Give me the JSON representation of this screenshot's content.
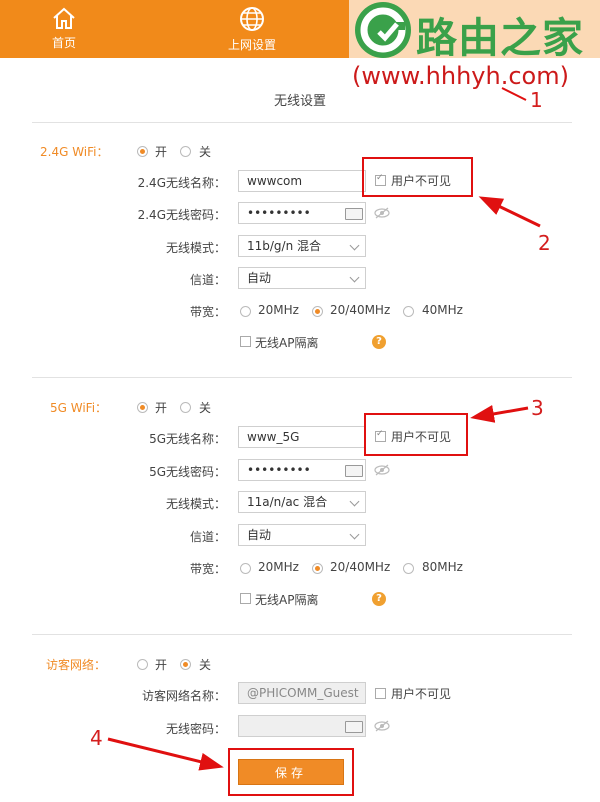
{
  "nav": {
    "home_label": "首页",
    "internet_label": "上网设置",
    "accent": "#f18a1a"
  },
  "watermark": {
    "brand": "路由之家",
    "url": "(www.hhhyh.com)"
  },
  "page_title": "无线设置",
  "wifi24": {
    "section_label": "2.4G WiFi：",
    "on_label": "开",
    "off_label": "关",
    "enabled": true,
    "name_label": "2.4G无线名称：",
    "name_value": "wwwcom",
    "hidden_label": "用户不可见",
    "hidden_checked": true,
    "password_label": "2.4G无线密码：",
    "password_value": "•••••••••",
    "mode_label": "无线模式：",
    "mode_value": "11b/g/n 混合",
    "channel_label": "信道：",
    "channel_value": "自动",
    "bandwidth_label": "带宽：",
    "bandwidth_options": [
      "20MHz",
      "20/40MHz",
      "40MHz"
    ],
    "bandwidth_selected": "20/40MHz",
    "ap_isolation_label": "无线AP隔离",
    "ap_isolation_checked": false,
    "help": "?"
  },
  "wifi5": {
    "section_label": "5G WiFi：",
    "on_label": "开",
    "off_label": "关",
    "enabled": true,
    "name_label": "5G无线名称：",
    "name_value": "www_5G",
    "hidden_label": "用户不可见",
    "hidden_checked": true,
    "password_label": "5G无线密码：",
    "password_value": "•••••••••",
    "mode_label": "无线模式：",
    "mode_value": "11a/n/ac 混合",
    "channel_label": "信道：",
    "channel_value": "自动",
    "bandwidth_label": "带宽：",
    "bandwidth_options": [
      "20MHz",
      "20/40MHz",
      "80MHz"
    ],
    "bandwidth_selected": "20/40MHz",
    "ap_isolation_label": "无线AP隔离",
    "ap_isolation_checked": false,
    "help": "?"
  },
  "guest": {
    "section_label": "访客网络：",
    "on_label": "开",
    "off_label": "关",
    "enabled": false,
    "name_label": "访客网络名称：",
    "name_value": "@PHICOMM_Guest",
    "hidden_label": "用户不可见",
    "hidden_checked": false,
    "password_label": "无线密码：",
    "password_value": ""
  },
  "save_label": "保存",
  "callouts": [
    "1",
    "2",
    "3",
    "4"
  ],
  "colors": {
    "orange": "#f08b26",
    "callout_red": "#e01010",
    "logo_green": "#3aa14a",
    "url_red": "#cc1a1a"
  }
}
